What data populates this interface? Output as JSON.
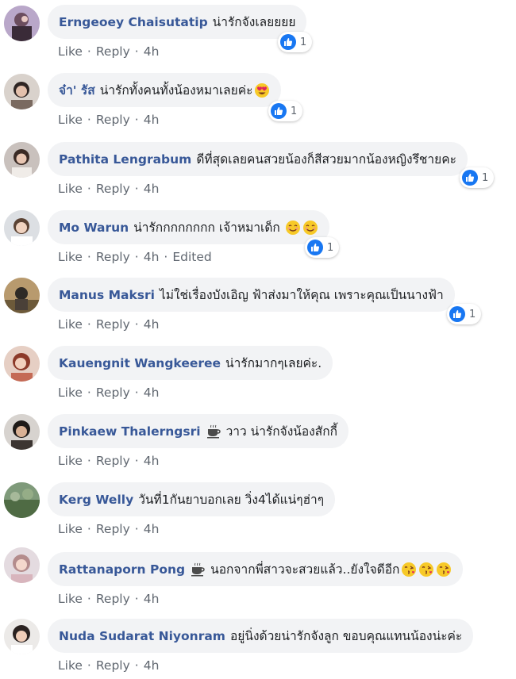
{
  "meta": {
    "like_label": "Like",
    "reply_label": "Reply",
    "separator": "·"
  },
  "comments": [
    {
      "author": "Erngeoey Chaisutatip",
      "text": "น่ารักจังเลยยยย",
      "time": "4h",
      "reactions": "1",
      "emoji": []
    },
    {
      "author": "จ๋า' รัส",
      "text": "น่ารักทั้งคนทั้งน้องหมาเลยค่ะ",
      "time": "4h",
      "reactions": "1",
      "emoji": [
        "heart-eyes-emoji"
      ]
    },
    {
      "author": "Pathita Lengrabum",
      "text": "ดีที่สุดเลยคนสวยน้องก็สีสวยมากน้องหญิงรึชายคะ",
      "time": "4h",
      "reactions": "1",
      "emoji": []
    },
    {
      "author": "Mo Warun",
      "text": "น่ารักกกกกกกก เจ้าหมาเด็ก",
      "time": "4h",
      "edited": "Edited",
      "reactions": "1",
      "emoji": [
        "smile-emoji",
        "smile-emoji"
      ]
    },
    {
      "author": "Manus Maksri",
      "text": "ไม่ใช่เรื่องบังเอิญ ฟ้าส่งมาให้คุณ เพราะคุณเป็นนางฟ้า",
      "time": "4h",
      "reactions": "1",
      "emoji": []
    },
    {
      "author": "Kauengnit Wangkeeree",
      "text": "น่ารักมากๆเลยค่ะ.",
      "time": "4h",
      "emoji": []
    },
    {
      "author": "Pinkaew Thalerngsri",
      "text": "วาว น่ารักจังน้องสักกี้",
      "time": "4h",
      "prefix_icon": "coffee-icon",
      "emoji": []
    },
    {
      "author": "Kerg Welly",
      "text": "วันที่1กันยาบอกเลย วิ่ง4ได้แน่ๆฮ่าๆ",
      "time": "4h",
      "emoji": []
    },
    {
      "author": "Rattanaporn Pong",
      "text": "นอกจากพี่สาวจะสวยแล้ว..ยังใจดีอีก",
      "time": "4h",
      "prefix_icon": "coffee-icon",
      "emoji": [
        "kiss-emoji",
        "kiss-emoji",
        "kiss-emoji"
      ]
    },
    {
      "author": "Nuda Sudarat Niyonram",
      "text": "อยู่นิ่งด้วยน่ารักจังลูก ขอบคุณแทนน้องน่ะค่ะ",
      "time": "4h",
      "emoji": []
    }
  ],
  "colors": {
    "author": "#385898",
    "bubble": "#f2f3f5",
    "meta": "#606770",
    "like": "#1877f2"
  }
}
